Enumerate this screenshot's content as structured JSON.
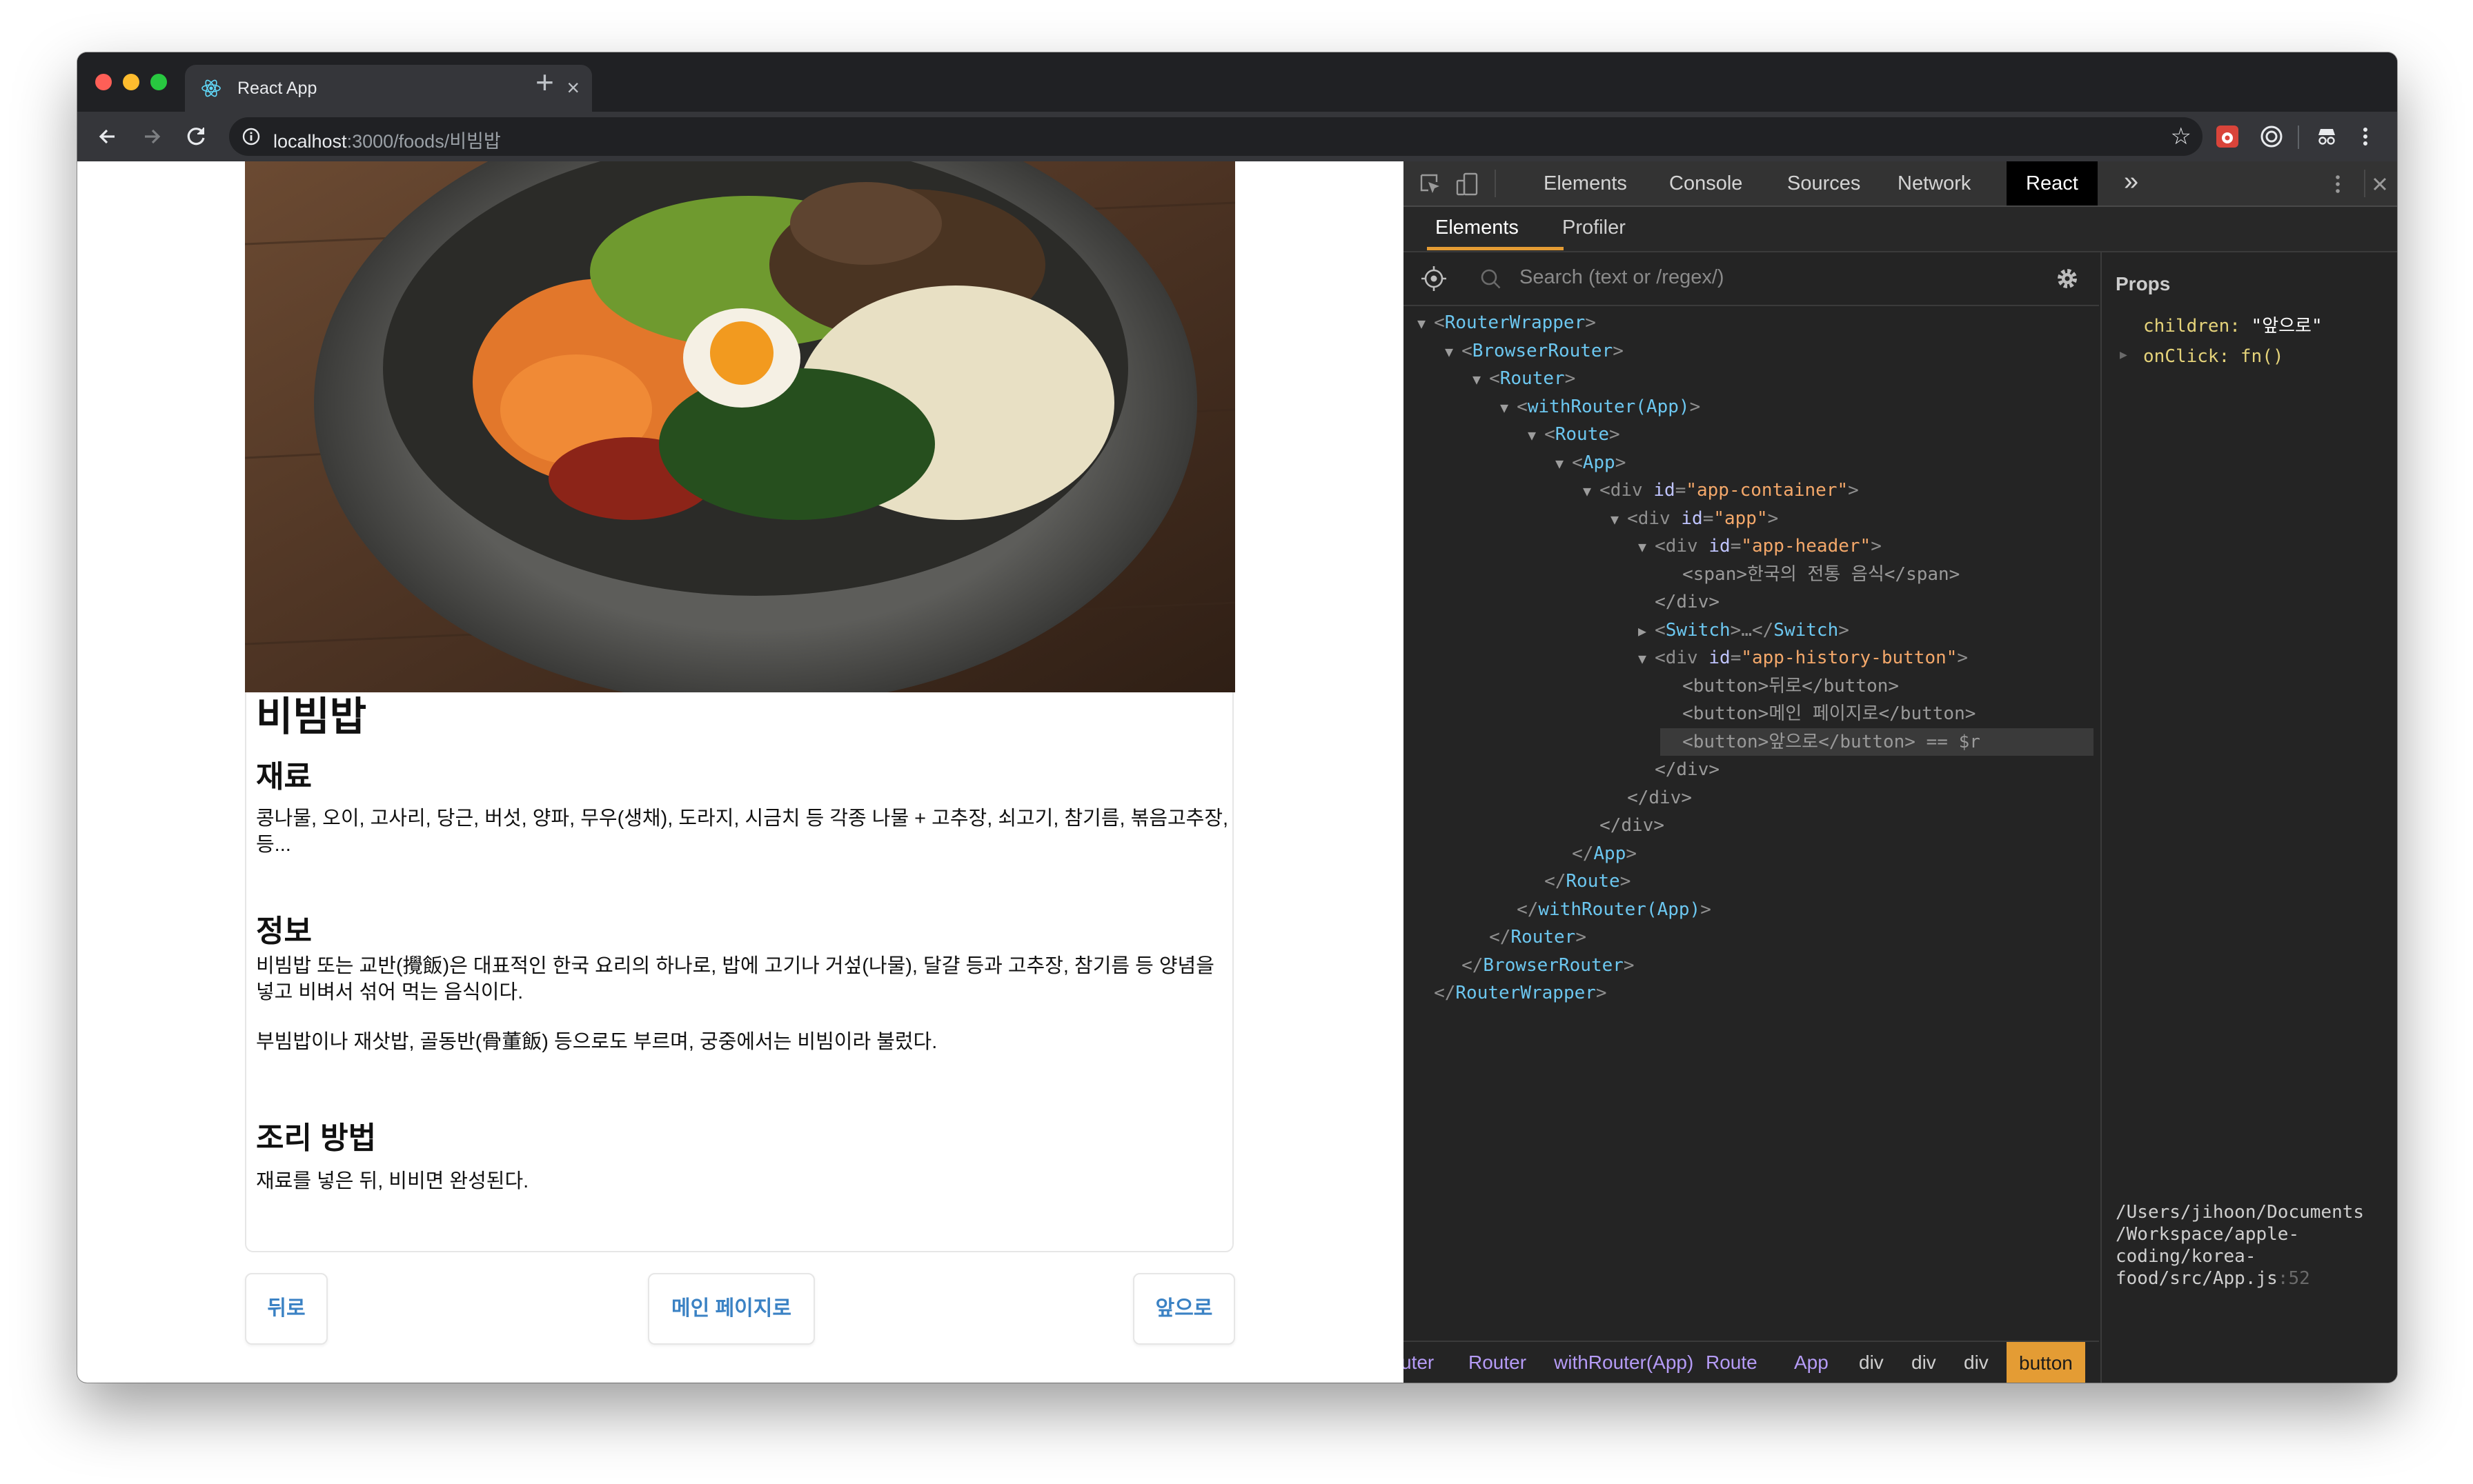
{
  "browser": {
    "tab_title": "React App",
    "url_host": "localhost",
    "url_path": ":3000/foods/비빔밥"
  },
  "page": {
    "title": "비빔밥",
    "ingredients_heading": "재료",
    "ingredients_text": "콩나물, 오이, 고사리, 당근, 버섯, 양파, 무우(생채), 도라지, 시금치 등 각종 나물 + 고추장, 쇠고기, 참기름, 볶음고추장, 등...",
    "info_heading": "정보",
    "info_text_1": "비빔밥 또는 교반(攪飯)은 대표적인 한국 요리의 하나로, 밥에 고기나 거섶(나물), 달걀 등과 고추장, 참기름 등 양념을 넣고 비벼서 섞어 먹는 음식이다.",
    "info_text_2": "부빔밥이나 재삿밥, 골동반(骨董飯) 등으로도 부르며, 궁중에서는 비빔이라 불렀다.",
    "recipe_heading": "조리 방법",
    "recipe_text": "재료를 넣은 뒤, 비비면 완성된다.",
    "buttons": {
      "back": "뒤로",
      "main": "메인 페이지로",
      "forward": "앞으로"
    }
  },
  "devtools": {
    "tabs": [
      "Elements",
      "Console",
      "Sources",
      "Network",
      "React"
    ],
    "active_tab": "React",
    "more_tabs": "»",
    "subtabs": [
      "Elements",
      "Profiler"
    ],
    "search_placeholder": "Search (text or /regex/)",
    "tree": [
      {
        "depth": 0,
        "tri": "▼",
        "open": "<",
        "name": "RouterWrapper",
        "close": ">"
      },
      {
        "depth": 1,
        "tri": "▼",
        "open": "<",
        "name": "BrowserRouter",
        "close": ">"
      },
      {
        "depth": 2,
        "tri": "▼",
        "open": "<",
        "name": "Router",
        "close": ">"
      },
      {
        "depth": 3,
        "tri": "▼",
        "open": "<",
        "name": "withRouter(App)",
        "close": ">"
      },
      {
        "depth": 4,
        "tri": "▼",
        "open": "<",
        "name": "Route",
        "close": ">"
      },
      {
        "depth": 5,
        "tri": "▼",
        "open": "<",
        "name": "App",
        "close": ">"
      },
      {
        "depth": 6,
        "tri": "▼",
        "open": "<",
        "name": "div",
        "html": true,
        "attr": "id",
        "val": "\"app-container\"",
        "close": ">"
      },
      {
        "depth": 7,
        "tri": "▼",
        "open": "<",
        "name": "div",
        "html": true,
        "attr": "id",
        "val": "\"app\"",
        "close": ">"
      },
      {
        "depth": 8,
        "tri": "▼",
        "open": "<",
        "name": "div",
        "html": true,
        "attr": "id",
        "val": "\"app-header\"",
        "close": ">"
      },
      {
        "depth": 9,
        "tri": "",
        "text": "<span>한국의 전통 음식</span>"
      },
      {
        "depth": 8,
        "tri": "",
        "text": "</div>"
      },
      {
        "depth": 8,
        "tri": "▶",
        "open": "<",
        "name": "Switch",
        "close": ">…</",
        "name2": "Switch",
        "close2": ">"
      },
      {
        "depth": 8,
        "tri": "▼",
        "open": "<",
        "name": "div",
        "html": true,
        "attr": "id",
        "val": "\"app-history-button\"",
        "close": ">"
      },
      {
        "depth": 9,
        "tri": "",
        "text": "<button>뒤로</button>"
      },
      {
        "depth": 9,
        "tri": "",
        "text": "<button>메인 페이지로</button>"
      },
      {
        "depth": 9,
        "tri": "",
        "text": "<button>앞으로</button> == $r",
        "selected": true
      },
      {
        "depth": 8,
        "tri": "",
        "text": "</div>"
      },
      {
        "depth": 7,
        "tri": "",
        "text": "</div>"
      },
      {
        "depth": 6,
        "tri": "",
        "text": "</div>"
      },
      {
        "depth": 5,
        "tri": "",
        "open": "</",
        "name": "App",
        "close": ">"
      },
      {
        "depth": 4,
        "tri": "",
        "open": "</",
        "name": "Route",
        "close": ">"
      },
      {
        "depth": 3,
        "tri": "",
        "open": "</",
        "name": "withRouter(App)",
        "close": ">"
      },
      {
        "depth": 2,
        "tri": "",
        "open": "</",
        "name": "Router",
        "close": ">"
      },
      {
        "depth": 1,
        "tri": "",
        "open": "</",
        "name": "BrowserRouter",
        "close": ">"
      },
      {
        "depth": 0,
        "tri": "",
        "open": "</",
        "name": "RouterWrapper",
        "close": ">"
      }
    ],
    "props_label": "Props",
    "props": [
      {
        "key": "children:",
        "value": "\"앞으로\"",
        "kind": "string"
      },
      {
        "key": "onClick:",
        "value": "fn()",
        "kind": "fn"
      }
    ],
    "source_path": "/Users/jihoon/Documents\n/Workspace/apple-\ncoding/korea-\nfood/src/App.js",
    "source_line": ":52",
    "breadcrumbs": [
      "uter",
      "Router",
      "withRouter(App)",
      "Route",
      "App",
      "div",
      "div",
      "div",
      "button"
    ],
    "active_breadcrumb": "button"
  },
  "colors": {
    "accent_orange": "#e49c34",
    "component_blue": "#6cc7f0",
    "link_blue": "#3b82c4"
  }
}
